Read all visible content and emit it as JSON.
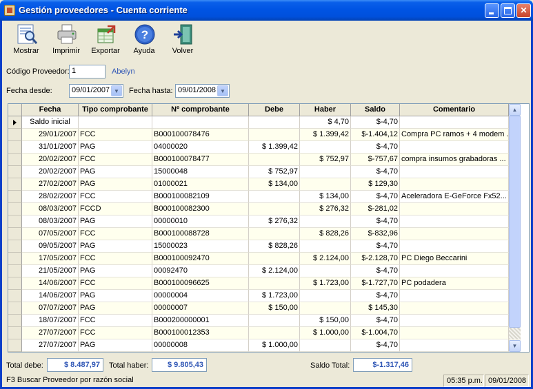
{
  "window": {
    "title": "Gestión proveedores - Cuenta corriente"
  },
  "toolbar": {
    "mostrar": "Mostrar",
    "imprimir": "Imprimir",
    "exportar": "Exportar",
    "ayuda": "Ayuda",
    "volver": "Volver"
  },
  "form": {
    "codigo_label": "Código Proveedor:",
    "codigo_value": "1",
    "proveedor_name": "Abelyn",
    "fecha_desde_label": "Fecha desde:",
    "fecha_desde_value": "09/01/2007",
    "fecha_hasta_label": "Fecha hasta:",
    "fecha_hasta_value": "09/01/2008"
  },
  "grid": {
    "columns": [
      "Fecha",
      "Tipo comprobante",
      "Nº comprobante",
      "Debe",
      "Haber",
      "Saldo",
      "Comentario"
    ],
    "rows": [
      [
        "Saldo inicial",
        "",
        "",
        "",
        "$ 4,70",
        "$-4,70",
        ""
      ],
      [
        "29/01/2007",
        "FCC",
        "B000100078476",
        "",
        "$ 1.399,42",
        "$-1.404,12",
        "Compra PC ramos + 4 modem ..."
      ],
      [
        "31/01/2007",
        "PAG",
        "04000020",
        "$ 1.399,42",
        "",
        "$-4,70",
        ""
      ],
      [
        "20/02/2007",
        "FCC",
        "B000100078477",
        "",
        "$ 752,97",
        "$-757,67",
        "compra insumos grabadoras ..."
      ],
      [
        "20/02/2007",
        "PAG",
        "15000048",
        "$ 752,97",
        "",
        "$-4,70",
        ""
      ],
      [
        "27/02/2007",
        "PAG",
        "01000021",
        "$ 134,00",
        "",
        "$ 129,30",
        ""
      ],
      [
        "28/02/2007",
        "FCC",
        "B000100082109",
        "",
        "$ 134,00",
        "$-4,70",
        "Aceleradora E-GeForce Fx52..."
      ],
      [
        "08/03/2007",
        "FCCD",
        "B000100082300",
        "",
        "$ 276,32",
        "$-281,02",
        ""
      ],
      [
        "08/03/2007",
        "PAG",
        "00000010",
        "$ 276,32",
        "",
        "$-4,70",
        ""
      ],
      [
        "07/05/2007",
        "FCC",
        "B000100088728",
        "",
        "$ 828,26",
        "$-832,96",
        ""
      ],
      [
        "09/05/2007",
        "PAG",
        "15000023",
        "$ 828,26",
        "",
        "$-4,70",
        ""
      ],
      [
        "17/05/2007",
        "FCC",
        "B000100092470",
        "",
        "$ 2.124,00",
        "$-2.128,70",
        "PC Diego Beccarini"
      ],
      [
        "21/05/2007",
        "PAG",
        "00092470",
        "$ 2.124,00",
        "",
        "$-4,70",
        ""
      ],
      [
        "14/06/2007",
        "FCC",
        "B000100096625",
        "",
        "$ 1.723,00",
        "$-1.727,70",
        "PC podadera"
      ],
      [
        "14/06/2007",
        "PAG",
        "00000004",
        "$ 1.723,00",
        "",
        "$-4,70",
        ""
      ],
      [
        "07/07/2007",
        "PAG",
        "00000007",
        "$ 150,00",
        "",
        "$ 145,30",
        ""
      ],
      [
        "18/07/2007",
        "FCC",
        "B000200000001",
        "",
        "$ 150,00",
        "$-4,70",
        ""
      ],
      [
        "27/07/2007",
        "FCC",
        "B000100012353",
        "",
        "$ 1.000,00",
        "$-1.004,70",
        ""
      ],
      [
        "27/07/2007",
        "PAG",
        "00000008",
        "$ 1.000,00",
        "",
        "$-4,70",
        ""
      ]
    ]
  },
  "totals": {
    "debe_label": "Total debe:",
    "debe_value": "$ 8.487,97",
    "haber_label": "Total haber:",
    "haber_value": "$ 9.805,43",
    "saldo_label": "Saldo Total:",
    "saldo_value": "$-1.317,46"
  },
  "statusbar": {
    "hint": "F3 Buscar Proveedor por razón social",
    "time": "05:35 p.m.",
    "date": "09/01/2008"
  }
}
